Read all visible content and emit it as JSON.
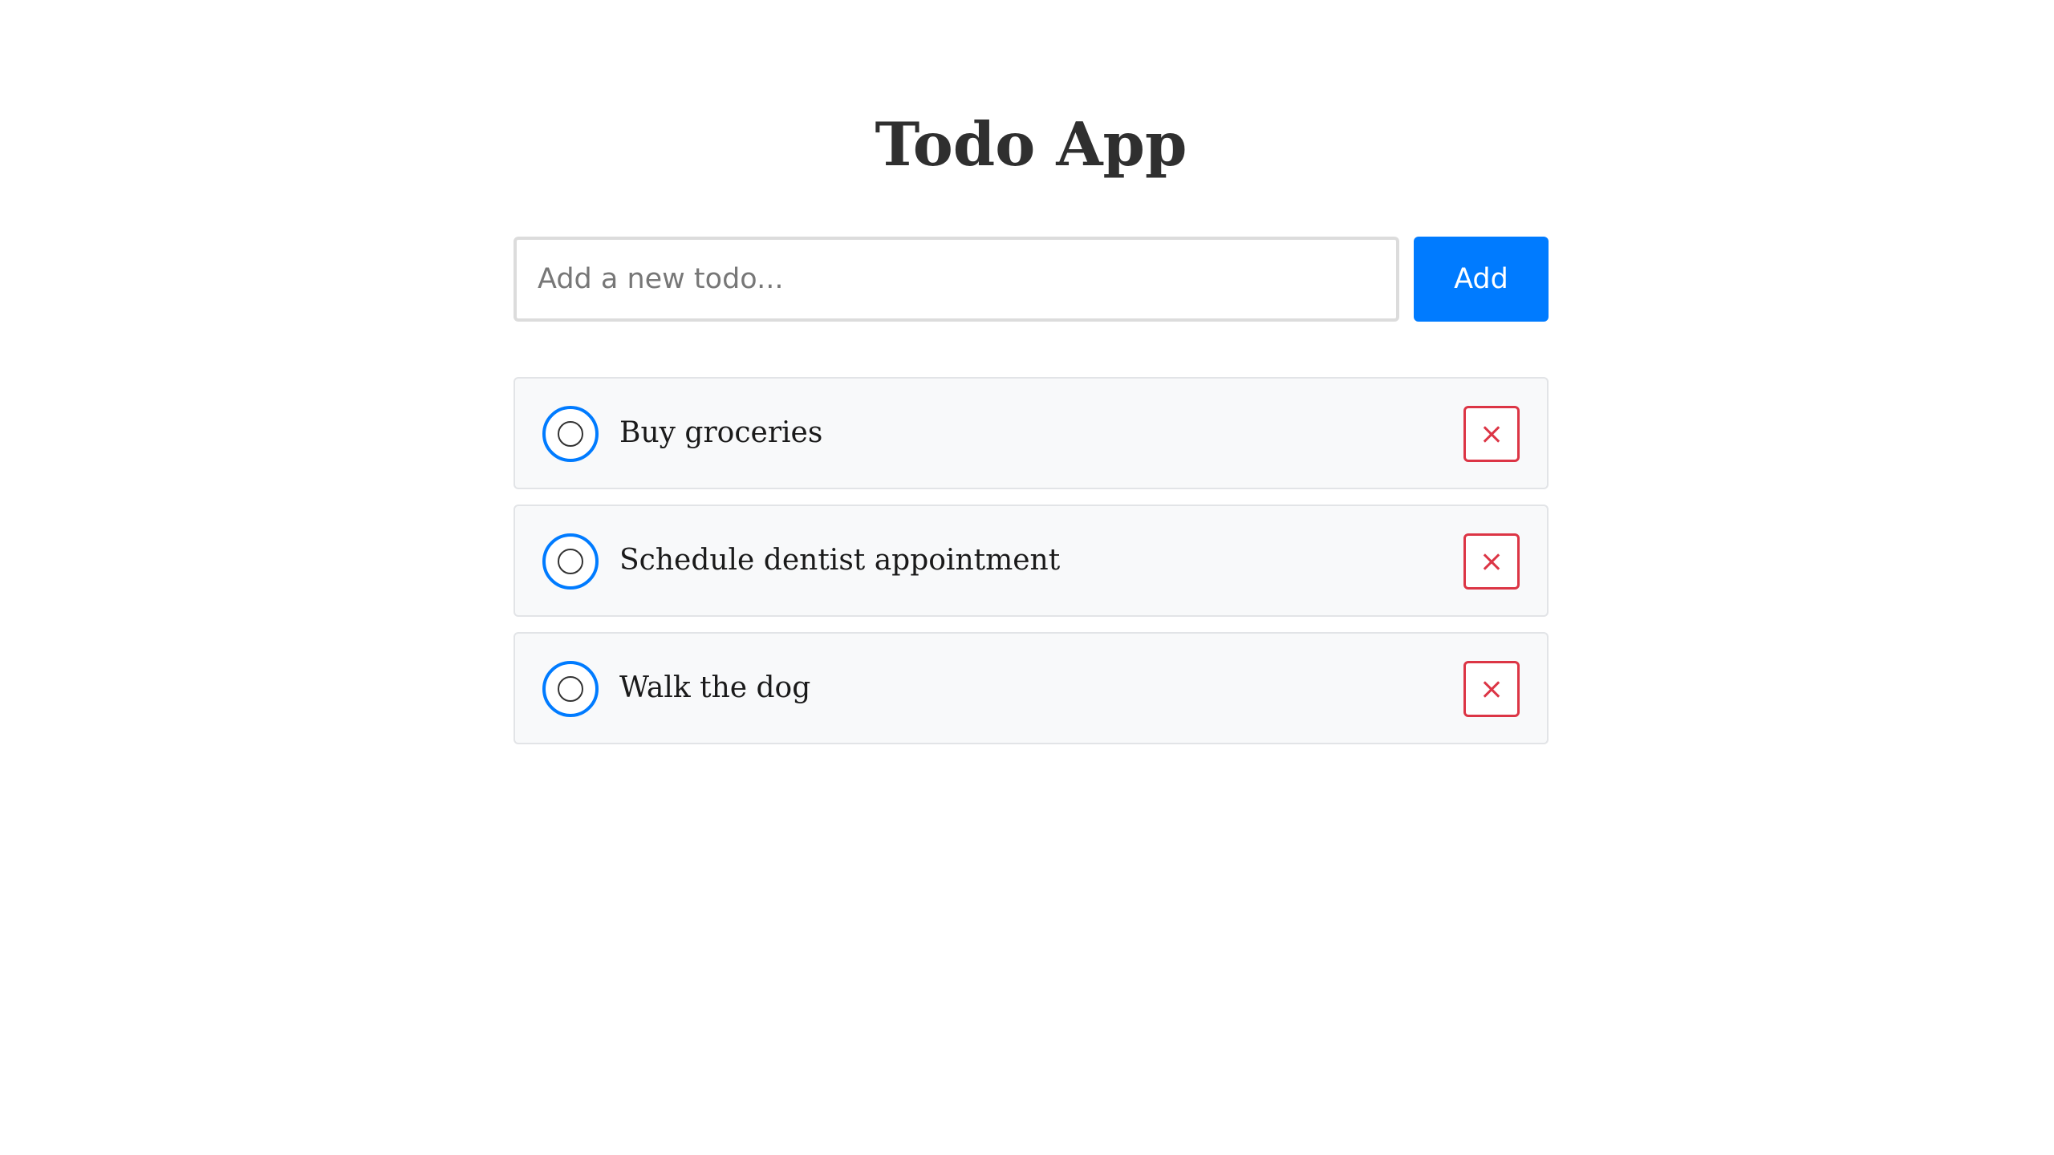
{
  "app": {
    "title": "Todo App"
  },
  "new_todo": {
    "placeholder": "Add a new todo...",
    "value": "",
    "add_label": "Add"
  },
  "todos": [
    {
      "text": "Buy groceries",
      "completed": false
    },
    {
      "text": "Schedule dentist appointment",
      "completed": false
    },
    {
      "text": "Walk the dog",
      "completed": false
    }
  ],
  "icons": {
    "toggle": "circle-icon",
    "delete": "close-icon"
  },
  "colors": {
    "primary": "#007bff",
    "danger": "#dc3545",
    "item_background": "#f8f9fa",
    "title_text": "#2f2f2f"
  }
}
